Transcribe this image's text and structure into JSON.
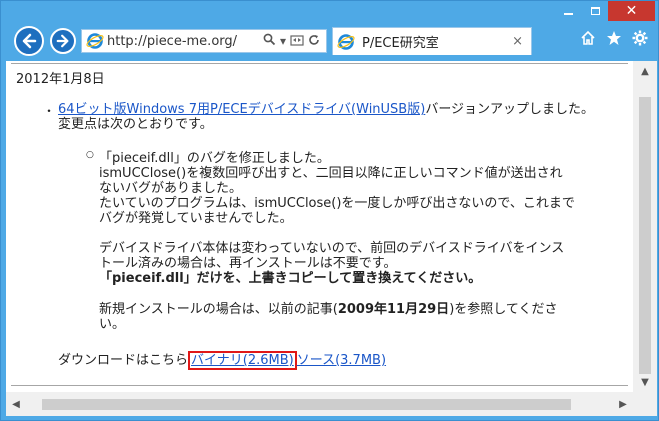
{
  "browser": {
    "url": "http://piece-me.org/",
    "tab_title": "P/ECE研究室",
    "tab_close": "×",
    "close_glyph": "✕",
    "home_icon": "home-icon",
    "favorites_icon": "star-icon",
    "tools_icon": "gear-icon",
    "accent_color": "#4ea9e6",
    "close_color": "#c7372f"
  },
  "page": {
    "date": "2012年1月8日",
    "item1_link": "64ビット版Windows 7用P/ECEデバイスドライバ(WinUSB版)",
    "item1_rest": "バージョンアップしました。",
    "item1_line2": "変更点は次のとおりです。",
    "sub_line1": "「pieceif.dll」のバグを修正しました。",
    "sub_line2": "ismUCClose()を複数回呼び出すと、二回目以降に正しいコマンド値が送出され",
    "sub_line3": "ないバグがありました。",
    "sub_line4": "たいていのプログラムは、ismUCClose()を一度しか呼び出さないので、これまで",
    "sub_line5": "バグが発覚していませんでした。",
    "sub_line6": "デバイスドライバ本体は変わっていないので、前回のデバイスドライバをインス",
    "sub_line7": "トール済みの場合は、再インストールは不要です。",
    "sub_line8": "「pieceif.dll」だけを、上書きコピーして置き換えてください。",
    "sub_line9_pre": "新規インストールの場合は、以前の記事(",
    "sub_line9_bold": "2009年11月29日",
    "sub_line9_post": ")を参照してくださ",
    "sub_line10": "い。",
    "download_label": "ダウンロードはこちら",
    "binary_link": "バイナリ(2.6MB)",
    "source_link": "ソース(3.7MB)"
  }
}
